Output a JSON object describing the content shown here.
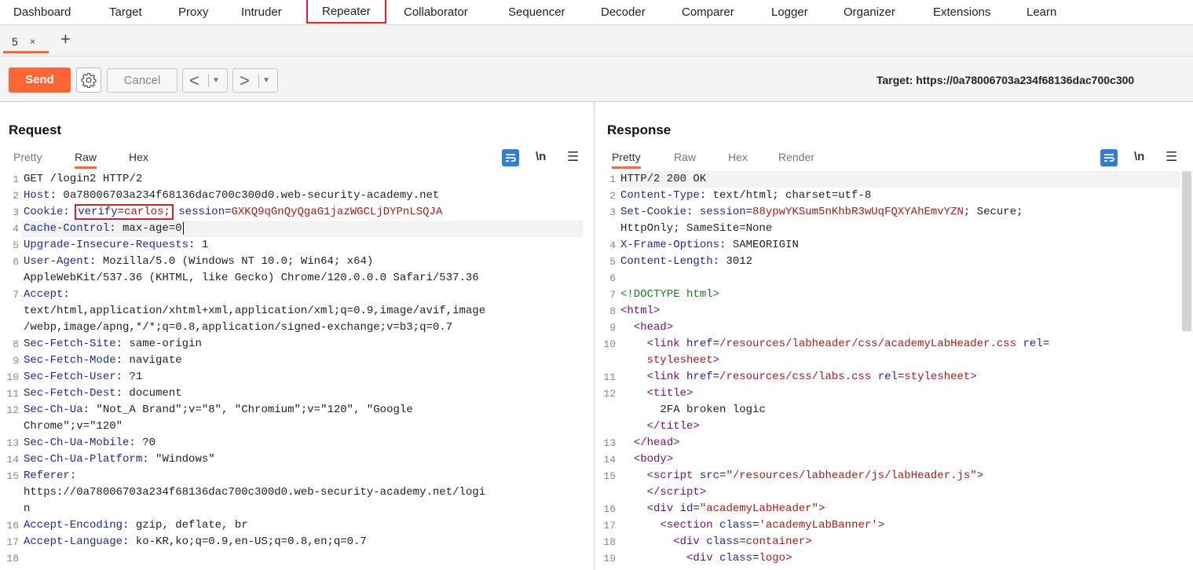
{
  "nav": {
    "items": [
      "Dashboard",
      "Target",
      "Proxy",
      "Intruder",
      "Repeater",
      "Collaborator",
      "Sequencer",
      "Decoder",
      "Comparer",
      "Logger",
      "Organizer",
      "Extensions",
      "Learn"
    ],
    "active": "Repeater"
  },
  "tabs": {
    "current": "5",
    "close": "×",
    "add": "+"
  },
  "toolbar": {
    "send": "Send",
    "cancel": "Cancel",
    "target": "Target: https://0a78006703a234f68136dac700c300"
  },
  "request": {
    "title": "Request",
    "tabs": [
      "Pretty",
      "Raw",
      "Hex"
    ],
    "active_tab": "Raw",
    "lines": [
      {
        "n": "1",
        "text": "GET /login2 HTTP/2"
      },
      {
        "n": "2",
        "key": "Host",
        "val": "0a78006703a234f68136dac700c300d0.web-security-academy.net"
      },
      {
        "n": "3",
        "key": "Cookie",
        "c1k": "verify",
        "c1v": "carlos;",
        "c2k": "session",
        "c2v": "GXKQ9qGnQyQgaG1jazWGCLjDYPnLSQJA"
      },
      {
        "n": "4",
        "key": "Cache-Control",
        "val": "max-age=0"
      },
      {
        "n": "5",
        "key": "Upgrade-Insecure-Requests",
        "val": "1"
      },
      {
        "n": "6",
        "key": "User-Agent",
        "val": "Mozilla/5.0 (Windows NT 10.0; Win64; x64)"
      },
      {
        "n": "",
        "text": "AppleWebKit/537.36 (KHTML, like Gecko) Chrome/120.0.0.0 Safari/537.36"
      },
      {
        "n": "7",
        "key": "Accept",
        "val": ""
      },
      {
        "n": "",
        "text": "text/html,application/xhtml+xml,application/xml;q=0.9,image/avif,image"
      },
      {
        "n": "",
        "text": "/webp,image/apng,*/*;q=0.8,application/signed-exchange;v=b3;q=0.7"
      },
      {
        "n": "8",
        "key": "Sec-Fetch-Site",
        "val": "same-origin"
      },
      {
        "n": "9",
        "key": "Sec-Fetch-Mode",
        "val": "navigate"
      },
      {
        "n": "10",
        "key": "Sec-Fetch-User",
        "val": "?1"
      },
      {
        "n": "11",
        "key": "Sec-Fetch-Dest",
        "val": "document"
      },
      {
        "n": "12",
        "key": "Sec-Ch-Ua",
        "val": "\"Not_A Brand\";v=\"8\", \"Chromium\";v=\"120\", \"Google"
      },
      {
        "n": "",
        "text": "Chrome\";v=\"120\""
      },
      {
        "n": "13",
        "key": "Sec-Ch-Ua-Mobile",
        "val": "?0"
      },
      {
        "n": "14",
        "key": "Sec-Ch-Ua-Platform",
        "val": "\"Windows\""
      },
      {
        "n": "15",
        "key": "Referer",
        "val": ""
      },
      {
        "n": "",
        "text": "https://0a78006703a234f68136dac700c300d0.web-security-academy.net/logi"
      },
      {
        "n": "",
        "text": "n"
      },
      {
        "n": "16",
        "key": "Accept-Encoding",
        "val": "gzip, deflate, br"
      },
      {
        "n": "17",
        "key": "Accept-Language",
        "val": "ko-KR,ko;q=0.9,en-US;q=0.8,en;q=0.7"
      },
      {
        "n": "18",
        "text": ""
      }
    ]
  },
  "response": {
    "title": "Response",
    "tabs": [
      "Pretty",
      "Raw",
      "Hex",
      "Render"
    ],
    "active_tab": "Pretty",
    "lines": [
      {
        "n": "1",
        "text": "HTTP/2 200 OK"
      },
      {
        "n": "2",
        "key": "Content-Type",
        "val": "text/html; charset=utf-8"
      },
      {
        "n": "3",
        "key": "Set-Cookie",
        "sk": "session",
        "sv": "88ypwYKSum5nKhbR3wUqFQXYAhEmvYZN",
        "rest": "; Secure;"
      },
      {
        "n": "",
        "text": "HttpOnly; SameSite=None"
      },
      {
        "n": "4",
        "key": "X-Frame-Options",
        "val": "SAMEORIGIN"
      },
      {
        "n": "5",
        "key": "Content-Length",
        "val": "3012"
      },
      {
        "n": "6",
        "text": ""
      },
      {
        "n": "7",
        "html": "<span class='g'>&lt;!DOCTYPE html&gt;</span>"
      },
      {
        "n": "8",
        "html": "<span class='t'>&lt;html&gt;</span>"
      },
      {
        "n": "9",
        "html": "  <span class='t'>&lt;head&gt;</span>"
      },
      {
        "n": "10",
        "html": "    <span class='t'>&lt;link</span> <span class='a'>href</span>=<span class='v'>/resources/labheader/css/academyLabHeader.css</span> <span class='a'>rel</span>="
      },
      {
        "n": "",
        "html": "    <span class='v'>stylesheet</span><span class='t'>&gt;</span>"
      },
      {
        "n": "11",
        "html": "    <span class='t'>&lt;link</span> <span class='a'>href</span>=<span class='v'>/resources/css/labs.css</span> <span class='a'>rel</span>=<span class='v'>stylesheet</span><span class='t'>&gt;</span>"
      },
      {
        "n": "12",
        "html": "    <span class='t'>&lt;title&gt;</span>"
      },
      {
        "n": "",
        "html": "      2FA broken logic"
      },
      {
        "n": "",
        "html": "    <span class='t'>&lt;/title&gt;</span>"
      },
      {
        "n": "13",
        "html": "  <span class='t'>&lt;/head&gt;</span>"
      },
      {
        "n": "14",
        "html": "  <span class='t'>&lt;body&gt;</span>"
      },
      {
        "n": "15",
        "html": "    <span class='t'>&lt;script</span> <span class='a'>src</span>=<span class='v'>\"/resources/labheader/js/labHeader.js\"</span><span class='t'>&gt;</span>"
      },
      {
        "n": "",
        "html": "    <span class='t'>&lt;/script&gt;</span>"
      },
      {
        "n": "16",
        "html": "    <span class='t'>&lt;div</span> <span class='a'>id</span>=<span class='v'>\"academyLabHeader\"</span><span class='t'>&gt;</span>"
      },
      {
        "n": "17",
        "html": "      <span class='t'>&lt;section</span> <span class='a'>class</span>=<span class='v'>'academyLabBanner'</span><span class='t'>&gt;</span>"
      },
      {
        "n": "18",
        "html": "        <span class='t'>&lt;div</span> <span class='a'>class</span>=<span class='v'>container</span><span class='t'>&gt;</span>"
      },
      {
        "n": "19",
        "html": "          <span class='t'>&lt;div</span> <span class='a'>class</span>=<span class='v'>logo</span><span class='t'>&gt;</span>"
      }
    ]
  },
  "colors": {
    "accent": "#ff6633",
    "highlight_box": "#d0202a",
    "header_key": "#1a2a9a",
    "header_value": "#b01818",
    "toggle_active": "#2e7fd6"
  },
  "icons": [
    "close-icon",
    "plus-icon",
    "gear-icon",
    "chevron-left-icon",
    "chevron-right-icon",
    "dropdown-icon",
    "wrap-icon",
    "newline-icon",
    "menu-icon",
    "layout-icon"
  ]
}
